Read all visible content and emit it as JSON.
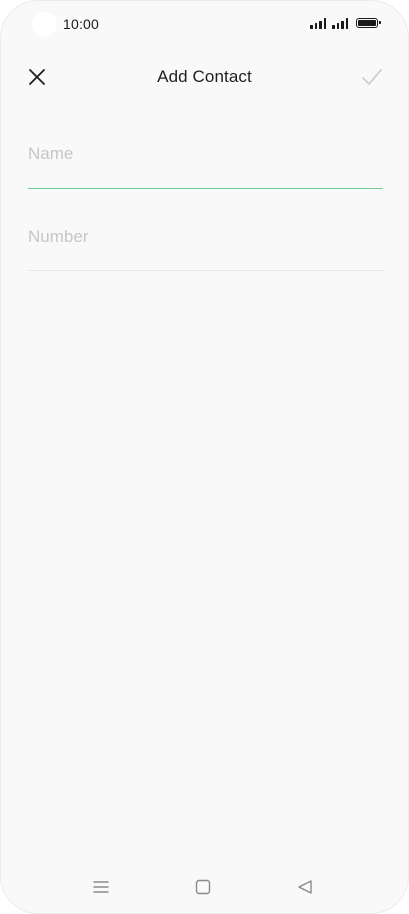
{
  "status_bar": {
    "time": "10:00",
    "icons": [
      "signal-icon",
      "signal-icon",
      "battery-icon"
    ]
  },
  "app_bar": {
    "title": "Add Contact",
    "close_icon": "close-icon",
    "confirm_icon": "checkmark-icon"
  },
  "form": {
    "name": {
      "placeholder": "Name",
      "value": ""
    },
    "number": {
      "placeholder": "Number",
      "value": ""
    }
  },
  "nav_bar": {
    "icons": [
      "menu-icon",
      "home-icon",
      "back-icon"
    ]
  },
  "colors": {
    "background": "#f9f9f9",
    "accent": "#7acc8a",
    "text": "#1f1f1f",
    "placeholder": "#c6c6c6",
    "disabled_icon": "#cfcfcf"
  }
}
